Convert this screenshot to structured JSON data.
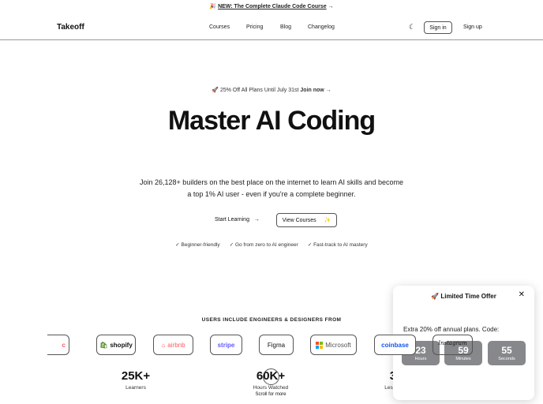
{
  "banner": {
    "emoji": "🎉",
    "text": "NEW: The Complete Claude Code Course",
    "arrow": "→"
  },
  "nav": {
    "logo": "Takeoff",
    "links": [
      "Courses",
      "Pricing",
      "Blog",
      "Changelog"
    ],
    "theme_icon": "moon-icon",
    "sign_in": "Sign in",
    "sign_up": "Sign up"
  },
  "hero": {
    "promo_emoji": "🚀",
    "promo_text": "25% Off All Plans Until July 31st",
    "promo_link": "Join now →",
    "title": "Master AI Coding",
    "desc_line1": "Join 26,128+ builders on the best place on the internet to learn AI skills and become",
    "desc_line2": "a top 1% AI user - even if you're a complete beginner.",
    "start": "Start Learning",
    "start_arrow": "→",
    "view": "View Courses",
    "view_icon": "sparkle-icon",
    "checks": [
      "Beginner-friendly",
      "Go from zero to AI engineer",
      "Fast-track to AI mastery"
    ]
  },
  "logos": {
    "heading": "USERS INCLUDE ENGINEERS & DESIGNERS FROM",
    "items": [
      "c",
      "shopify",
      "airbnb",
      "stripe",
      "Figma",
      "Microsoft",
      "coinbase",
      "Instagram"
    ]
  },
  "stats": [
    {
      "value": "25K+",
      "label": "Learners"
    },
    {
      "value": "60K+",
      "label": "Hours Watched"
    },
    {
      "value": "300K+",
      "label": "Lessons Completed"
    }
  ],
  "scroll": {
    "text": "Scroll for more",
    "icon": "chevron-down-icon"
  },
  "popup": {
    "emoji": "🚀",
    "title": "Limited Time Offer",
    "close": "✕",
    "text": "Extra 20% off annual plans. Code:",
    "countdown": [
      {
        "value": "23",
        "label": "Hours"
      },
      {
        "value": "59",
        "label": "Minutes"
      },
      {
        "value": "55",
        "label": "Seconds"
      }
    ]
  },
  "colors": {
    "countdown_bg": "#86888c",
    "shopify": "#5a8a2a",
    "airbnb": "#ff5a5f",
    "stripe": "#635bff",
    "coinbase": "#1652f0"
  }
}
